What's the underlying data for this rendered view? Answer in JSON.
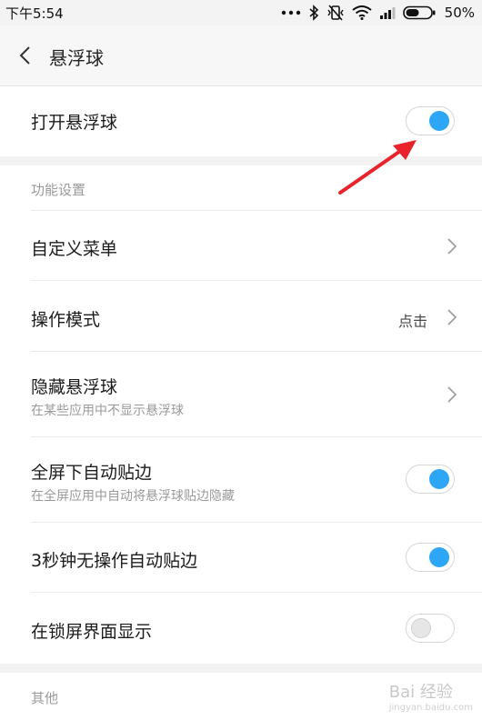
{
  "status_bar": {
    "time": "下午5:54",
    "battery": "50%",
    "icons": [
      "dots-icon",
      "bluetooth-icon",
      "vibrate-icon",
      "wifi-icon",
      "signal-icon",
      "battery-icon"
    ]
  },
  "header": {
    "title": "悬浮球"
  },
  "items": {
    "open_ball": {
      "label": "打开悬浮球",
      "toggle": "on"
    },
    "section_func": "功能设置",
    "custom_menu": {
      "label": "自定义菜单"
    },
    "op_mode": {
      "label": "操作模式",
      "value": "点击"
    },
    "hide_ball": {
      "label": "隐藏悬浮球",
      "sub": "在某些应用中不显示悬浮球"
    },
    "fullscreen_edge": {
      "label": "全屏下自动贴边",
      "sub": "在全屏应用中自动将悬浮球贴边隐藏",
      "toggle": "on"
    },
    "idle_edge": {
      "label": "3秒钟无操作自动贴边",
      "toggle": "on"
    },
    "lock_show": {
      "label": "在锁屏界面显示",
      "toggle": "off"
    },
    "section_other": "其他"
  },
  "colors": {
    "toggle_on": "#2ea6f6",
    "annotation_arrow": "#e8232b"
  },
  "watermark": {
    "brand": "Bai 经验",
    "url": "jingyan.baidu.com"
  }
}
